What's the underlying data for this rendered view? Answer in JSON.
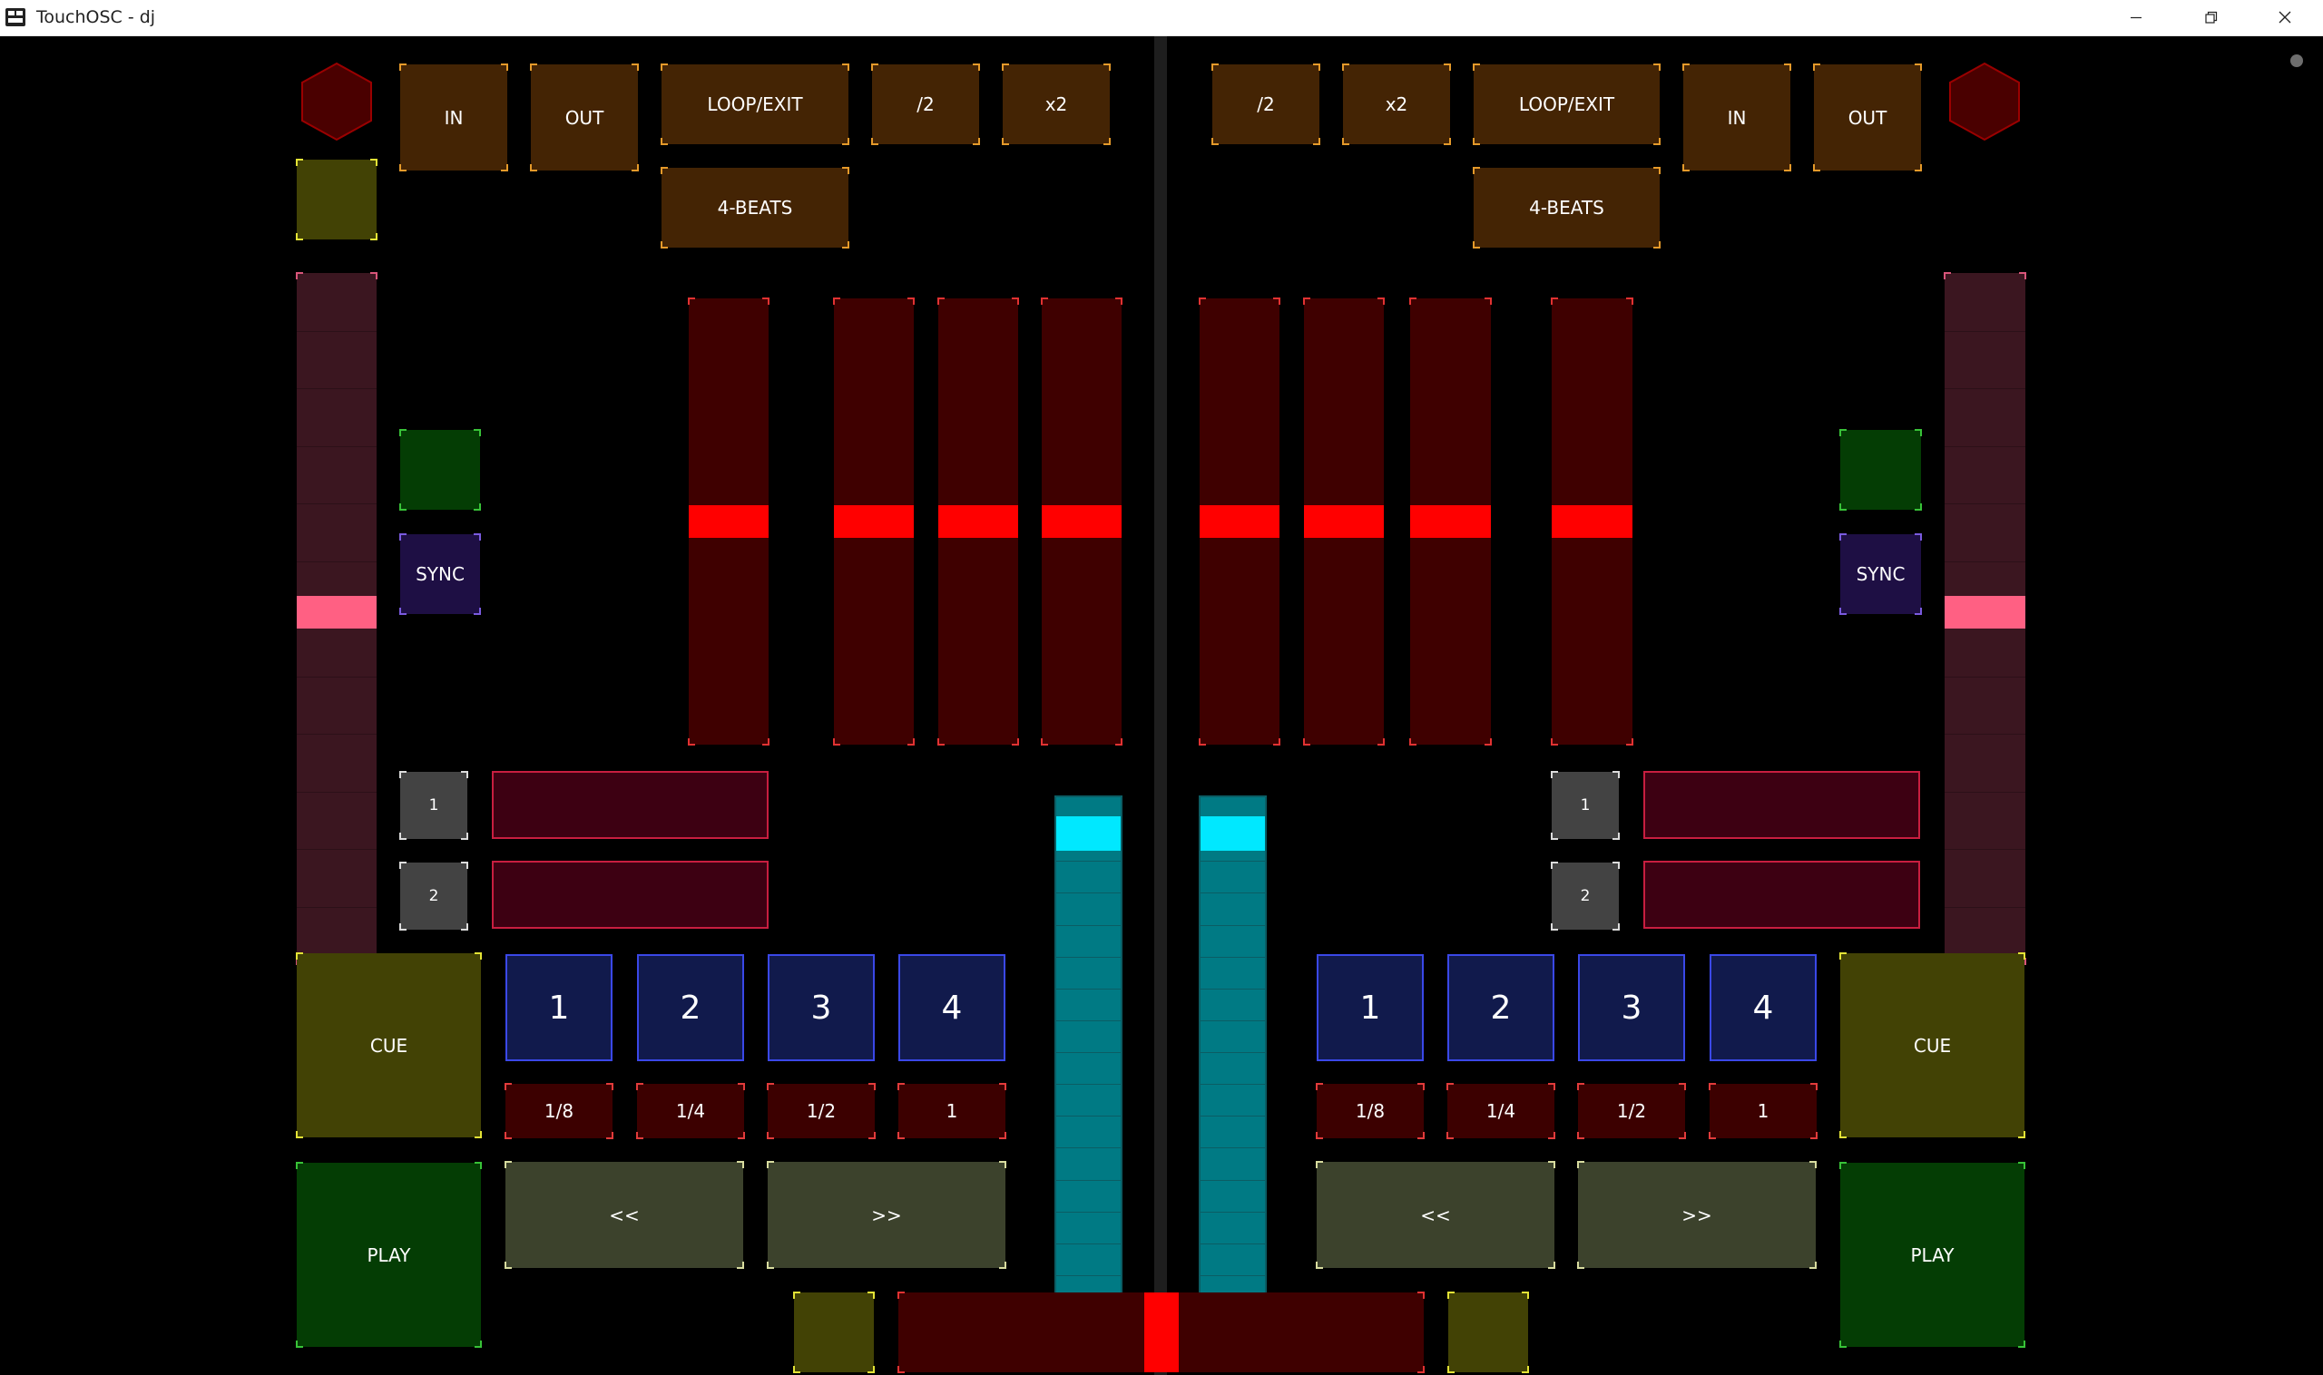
{
  "window": {
    "title": "TouchOSC - dj"
  },
  "colors": {
    "canvas": "#000000",
    "loop_button": "#442404",
    "loop_corner": "#e59a2a",
    "olive_button": "#424205",
    "olive_corner": "#e3e336",
    "green_button": "#043d04",
    "green_corner": "#38c238",
    "sync_button": "#1e0f44",
    "sync_corner": "#7a5adf",
    "gray_button": "#434343",
    "gray_corner": "#dcdcdc",
    "hotcue_button": "#111a4c",
    "hotcue_border": "#3a48e8",
    "beat_button": "#3c0000",
    "beat_corner": "#e23b3b",
    "nudge_button": "#3c422c",
    "nudge_corner": "#d8dc9f",
    "eq_fader_track": "#3f0000",
    "eq_fader_handle": "#ff0000",
    "eq_fader_corner": "#e13232",
    "pitch_track": "#3b1620",
    "pitch_handle": "#ff6083",
    "pitch_corner": "#d9557a",
    "volume_track": "#007a84",
    "volume_handle": "#00e8ff",
    "volume_line": "#0b5d64",
    "fx_field": "#3d0012",
    "fx_border": "#c81e40",
    "crossfader_track": "#3f0000",
    "crossfader_handle": "#ff0000",
    "hexagon": "#4a0000",
    "hexagon_border": "#9a0000"
  },
  "decks": {
    "left": {
      "loop_in": "IN",
      "loop_out": "OUT",
      "loop_exit": "LOOP/EXIT",
      "half": "/2",
      "double": "x2",
      "four_beats": "4-BEATS",
      "sync": "SYNC",
      "fx_1": "1",
      "fx_2": "2",
      "cue": "CUE",
      "play": "PLAY",
      "rewind": "<<",
      "forward": ">>",
      "hotcues": [
        "1",
        "2",
        "3",
        "4"
      ],
      "beat_jumps": [
        "1/8",
        "1/4",
        "1/2",
        "1"
      ],
      "pitch_level": 0.51,
      "volume_level": 0.96
    },
    "right": {
      "loop_in": "IN",
      "loop_out": "OUT",
      "loop_exit": "LOOP/EXIT",
      "half": "/2",
      "double": "x2",
      "four_beats": "4-BEATS",
      "sync": "SYNC",
      "fx_1": "1",
      "fx_2": "2",
      "cue": "CUE",
      "play": "PLAY",
      "rewind": "<<",
      "forward": ">>",
      "hotcues": [
        "1",
        "2",
        "3",
        "4"
      ],
      "beat_jumps": [
        "1/8",
        "1/4",
        "1/2",
        "1"
      ],
      "pitch_level": 0.51,
      "volume_level": 0.96
    }
  },
  "eq_fader_levels": [
    0.5,
    0.5,
    0.5,
    0.5,
    0.5,
    0.5,
    0.5,
    0.5
  ],
  "crossfader_level": 0.5
}
